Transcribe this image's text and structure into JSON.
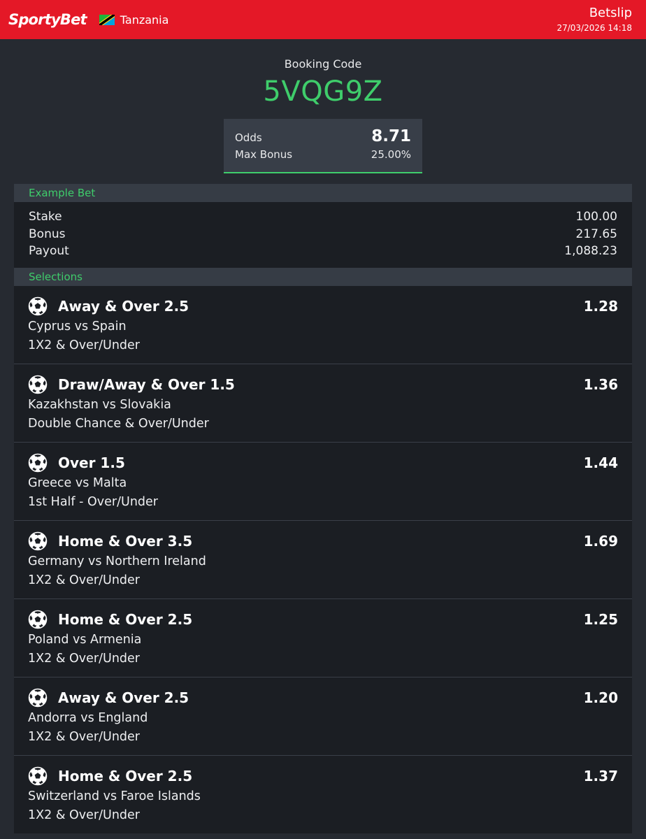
{
  "header": {
    "logo_text": "SportyBet",
    "country": "Tanzania",
    "title": "Betslip",
    "datetime": "27/03/2026 14:18",
    "colors": {
      "brand_red": "#e41827"
    },
    "flag_icon": "tanzania-flag-icon"
  },
  "booking": {
    "label": "Booking Code",
    "code": "5VQG9Z",
    "odds_label": "Odds",
    "odds_value": "8.71",
    "bonus_label": "Max Bonus",
    "bonus_value": "25.00%",
    "accent_color": "#3fcd6b"
  },
  "example_bet": {
    "title": "Example Bet",
    "rows": [
      {
        "label": "Stake",
        "value": "100.00"
      },
      {
        "label": "Bonus",
        "value": "217.65"
      },
      {
        "label": "Payout",
        "value": "1,088.23"
      }
    ]
  },
  "selections": {
    "title": "Selections",
    "icon": "soccer-ball-icon",
    "items": [
      {
        "pick": "Away & Over 2.5",
        "odds": "1.28",
        "match": "Cyprus vs Spain",
        "market": "1X2 & Over/Under"
      },
      {
        "pick": "Draw/Away & Over 1.5",
        "odds": "1.36",
        "match": "Kazakhstan vs Slovakia",
        "market": "Double Chance & Over/Under"
      },
      {
        "pick": "Over 1.5",
        "odds": "1.44",
        "match": "Greece vs Malta",
        "market": "1st Half - Over/Under"
      },
      {
        "pick": "Home & Over 3.5",
        "odds": "1.69",
        "match": "Germany vs Northern Ireland",
        "market": "1X2 & Over/Under"
      },
      {
        "pick": "Home & Over 2.5",
        "odds": "1.25",
        "match": "Poland vs Armenia",
        "market": "1X2 & Over/Under"
      },
      {
        "pick": "Away & Over 2.5",
        "odds": "1.20",
        "match": "Andorra vs England",
        "market": "1X2 & Over/Under"
      },
      {
        "pick": "Home & Over 2.5",
        "odds": "1.37",
        "match": "Switzerland vs Faroe Islands",
        "market": "1X2 & Over/Under"
      }
    ]
  }
}
